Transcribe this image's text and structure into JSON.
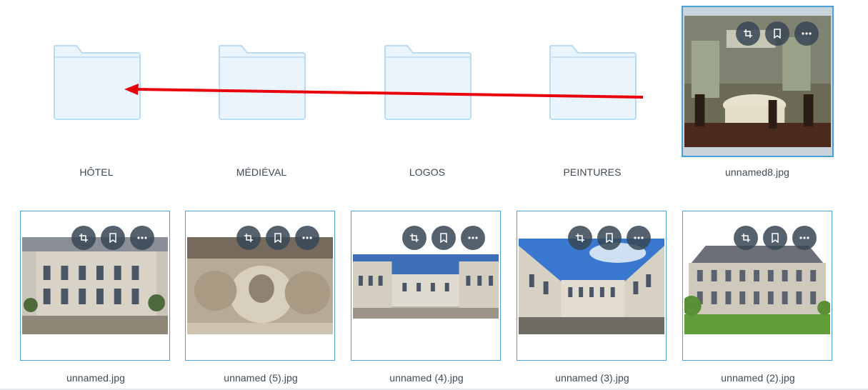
{
  "folders": [
    {
      "label": "HÔTEL"
    },
    {
      "label": "MÉDIÉVAL"
    },
    {
      "label": "LOGOS"
    },
    {
      "label": "PEINTURES"
    }
  ],
  "files": [
    {
      "label": "unnamed8.jpg",
      "selected": true
    },
    {
      "label": "unnamed.jpg"
    },
    {
      "label": "unnamed (5).jpg"
    },
    {
      "label": "unnamed (4).jpg"
    },
    {
      "label": "unnamed (3).jpg"
    },
    {
      "label": "unnamed (2).jpg"
    }
  ],
  "actions": [
    "crop-icon",
    "bookmark-icon",
    "more-icon"
  ],
  "colors": {
    "accent": "#4a9fd6",
    "folder_fill": "#eaf4fc",
    "folder_stroke": "#b9dcf3",
    "annotation_arrow": "#e8000b"
  }
}
